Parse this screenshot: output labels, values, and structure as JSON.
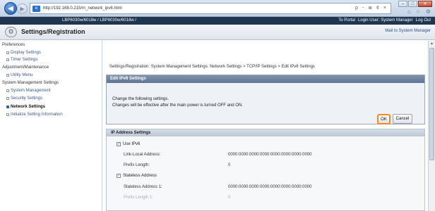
{
  "browser": {
    "url": "http://192.168.0.215/m_network_ipv6.html",
    "address_tools": "ρ - ≣ ¢ ×",
    "toolbar_icons": [
      "home-icon",
      "star-icon",
      "gear-icon"
    ]
  },
  "titlebar": {
    "device_name": "LBP6030w/6018w / LBP6030w/6018w /",
    "to_portal": "To Portal",
    "login_user": "Login User: System Manager",
    "log_out": "Log Out"
  },
  "header": {
    "title": "Settings/Registration",
    "mail_admin": "Mail to System Manager"
  },
  "sidebar": {
    "preferences": "Preferences",
    "display_settings": "Display Settings",
    "timer_settings": "Timer Settings",
    "adjustment": "Adjustment/Maintenance",
    "utility_menu": "Utility Menu",
    "system_mgmt": "System Management Settings",
    "system_management": "System Management",
    "security_settings": "Security Settings",
    "network_settings": "Network Settings",
    "initialize": "Initialize Setting Information"
  },
  "main": {
    "breadcrumb": "Settings/Registration: System Management Settings: Network Settings > TCP/IP Settings > Edit IPv6 Settings",
    "edit_title": "Edit IPv6 Settings",
    "msg1": "Change the following settings.",
    "msg2": "Changes will be effective after the main power is turned OFF and ON.",
    "ok": "OK",
    "cancel": "Cancel",
    "ip_title": "IP Address Settings",
    "use_ipv6": "Use IPv6",
    "link_local_label": "Link-Local Address:",
    "link_local_value": "0000:0000:0000:0000:0000:0000:0000:0000",
    "prefix_label": "Prefix Length:",
    "prefix_value": "0",
    "stateless": "Stateless Address",
    "stateless1_label": "Stateless Address 1:",
    "stateless1_value": "0000:0000:0000:0000:0000:0000:0000:0000",
    "prefix1_label": "Prefix Length 1:",
    "prefix1_value": "0"
  }
}
